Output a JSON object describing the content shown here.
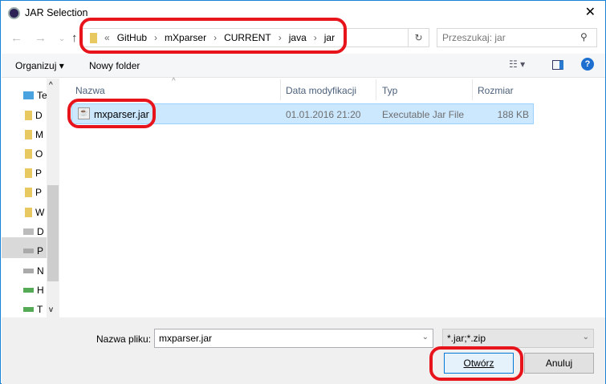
{
  "window": {
    "title": "JAR Selection",
    "close": "✕"
  },
  "address": {
    "overflow": "«",
    "path": [
      "GitHub",
      "mXparser",
      "CURRENT",
      "java",
      "jar"
    ]
  },
  "search": {
    "placeholder": "Przeszukaj: jar"
  },
  "toolbar": {
    "organize": "Organizuj",
    "new_folder": "Nowy folder"
  },
  "sidebar": {
    "items": [
      "Te",
      "D",
      "M",
      "O",
      "P",
      "P",
      "W",
      "D",
      "P",
      "N",
      "H",
      "T"
    ]
  },
  "columns": {
    "name": "Nazwa",
    "date": "Data modyfikacji",
    "type": "Typ",
    "size": "Rozmiar"
  },
  "files": [
    {
      "name": "mxparser.jar",
      "date": "01.01.2016 21:20",
      "type": "Executable Jar File",
      "size": "188 KB"
    }
  ],
  "footer": {
    "filename_label": "Nazwa pliku:",
    "filename": "mxparser.jar",
    "filter": "*.jar;*.zip",
    "open": "Otwórz",
    "cancel": "Anuluj"
  }
}
